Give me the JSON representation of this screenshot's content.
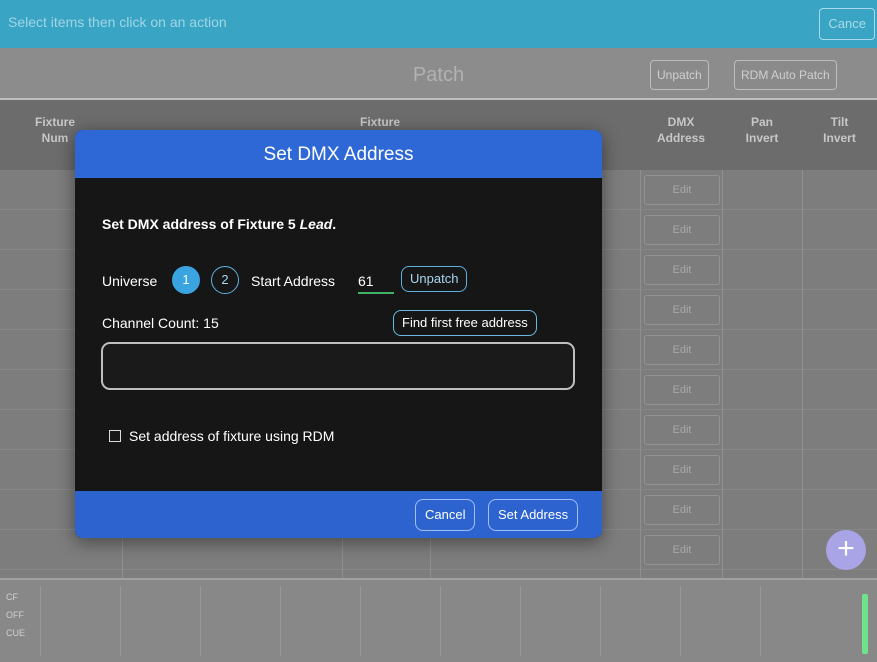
{
  "top_bar": {
    "hint": "Select items then click on an action",
    "cancel_label": "Cance"
  },
  "header": {
    "title": "Patch",
    "unpatch_label": "Unpatch",
    "rdm_label": "RDM Auto Patch"
  },
  "table": {
    "columns": {
      "fixture_number": "Fixture\nNum",
      "fixture": "Fixture",
      "dmx_address": "DMX\nAddress",
      "pan_invert": "Pan\nInvert",
      "tilt_invert": "Tilt\nInvert"
    },
    "rows": [
      "Edit",
      "Edit",
      "Edit",
      "Edit",
      "Edit",
      "Edit",
      "Edit",
      "Edit",
      "Edit",
      "Edit"
    ]
  },
  "add_icon": "+",
  "bottom_bar": {
    "labels": [
      "CF",
      "OFF",
      "CUE"
    ]
  },
  "dialog": {
    "title": "Set DMX Address",
    "heading_prefix": "Set DMX address of Fixture 5 ",
    "heading_fixture": "Lead",
    "heading_suffix": ".",
    "universe_label": "Universe",
    "universes": [
      "1",
      "2"
    ],
    "selected_universe": "1",
    "start_address_label": "Start Address",
    "start_address_value": "61",
    "unpatch_label": "Unpatch",
    "channel_count_label": "Channel Count: 15",
    "find_free_label": "Find first free address",
    "rdm_checkbox_label": "Set address of fixture using RDM",
    "rdm_checked": false,
    "cancel_label": "Cancel",
    "set_address_label": "Set Address"
  },
  "colors": {
    "dialog_header": "#2e67d6",
    "dialog_body": "#161616",
    "accent": "#3aa4e0",
    "top_bar": "#3aa4c4"
  }
}
